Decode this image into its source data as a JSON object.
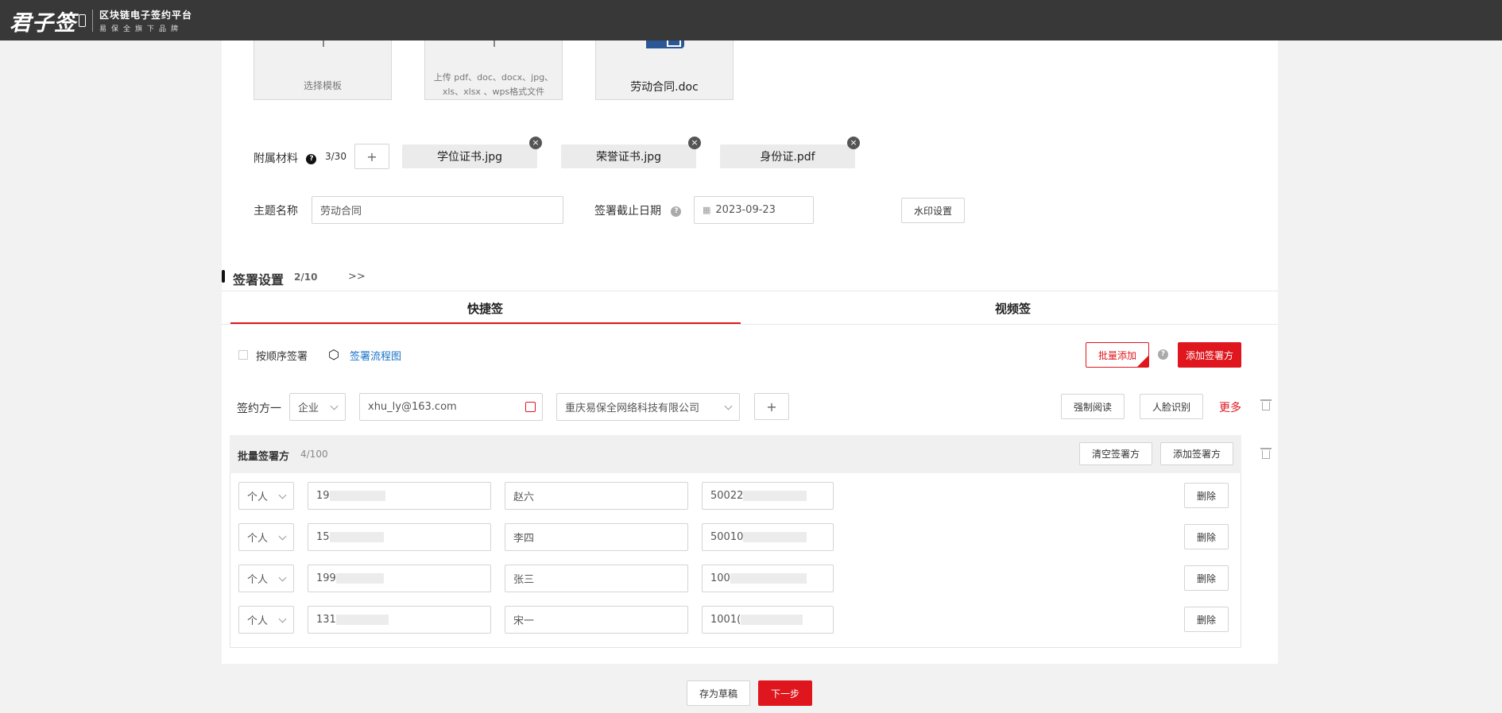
{
  "header": {
    "brand": "君子签",
    "brand_line1": "区块链电子签约平台",
    "brand_line2": "易保全旗下品牌"
  },
  "doc_cards": {
    "template_label": "选择模板",
    "upload_hint": "上传 pdf、doc、docx、jpg、xls、xlsx 、wps格式文件",
    "file_name": "劳动合同.doc"
  },
  "attachments": {
    "label": "附属材料",
    "count": "3/30",
    "add_symbol": "+",
    "files": [
      "学位证书.jpg",
      "荣誉证书.jpg",
      "身份证.pdf"
    ],
    "remove_symbol": "×"
  },
  "subject": {
    "label": "主题名称",
    "value": "劳动合同"
  },
  "deadline": {
    "label": "签署截止日期",
    "value": "2023-09-23"
  },
  "watermark_button": "水印设置",
  "sign_settings": {
    "title": "签署设置",
    "count": "2/10",
    "expand": ">>"
  },
  "tabs": [
    "快捷签",
    "视频签"
  ],
  "options": {
    "sequential_label": "按顺序签署",
    "flowchart_link": "签署流程图",
    "batch_add": "批量添加",
    "add_signer": "添加签署方"
  },
  "signer_one": {
    "label": "签约方一",
    "type": "企业",
    "email": "xhu_ly@163.com",
    "company": "重庆易保全网络科技有限公司",
    "add_symbol": "+",
    "forced_read": "强制阅读",
    "face_id": "人脸识别",
    "more": "更多"
  },
  "batch": {
    "title": "批量签署方",
    "count": "4/100",
    "clear_button": "清空签署方",
    "add_button": "添加签署方",
    "delete_label": "删除",
    "rows": [
      {
        "type": "个人",
        "phone": "19",
        "name": "赵六",
        "id": "50022"
      },
      {
        "type": "个人",
        "phone": "15",
        "name": "李四",
        "id": "50010"
      },
      {
        "type": "个人",
        "phone": "199",
        "name": "张三",
        "id": "100"
      },
      {
        "type": "个人",
        "phone": "131",
        "name": "宋一",
        "id": "1001("
      }
    ]
  },
  "footer": {
    "save_draft": "存为草稿",
    "next": "下一步"
  }
}
